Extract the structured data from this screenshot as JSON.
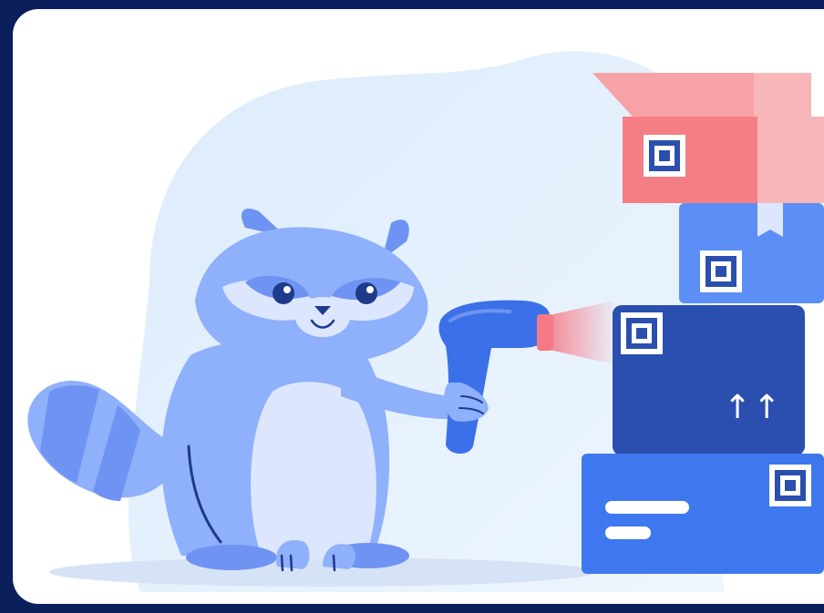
{
  "illustration": {
    "background_color": "#0b1f5c",
    "canvas_color": "#ffffff",
    "subject": "raccoon-with-barcode-scanner",
    "box_arrows": "↑↑"
  },
  "colors": {
    "raccoon_body": "#8fb0fb",
    "raccoon_dark": "#6f93f2",
    "raccoon_light": "#dce7ff",
    "scanner": "#3b70e8",
    "laser": "#f57a85",
    "box_red": "#f47e84",
    "box_blue": "#5b8ff5",
    "box_navy": "#2b4fae",
    "blob": "#e6f1fd"
  }
}
